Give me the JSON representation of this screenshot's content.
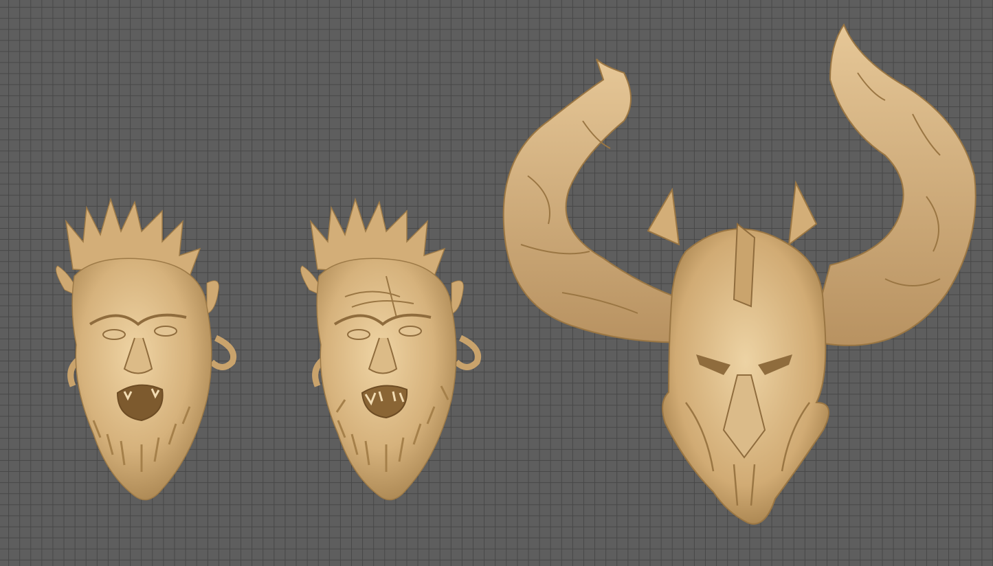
{
  "scene": {
    "background_color": "#5e5e5e",
    "grid_line_color": "#474747",
    "material_color": "#d9b886",
    "material_shadow": "#a9844f",
    "material_highlight": "#f1d9ad"
  },
  "models": [
    {
      "name": "orc-head-roaring"
    },
    {
      "name": "orc-head-roaring-detailed"
    },
    {
      "name": "horned-helmet"
    }
  ]
}
